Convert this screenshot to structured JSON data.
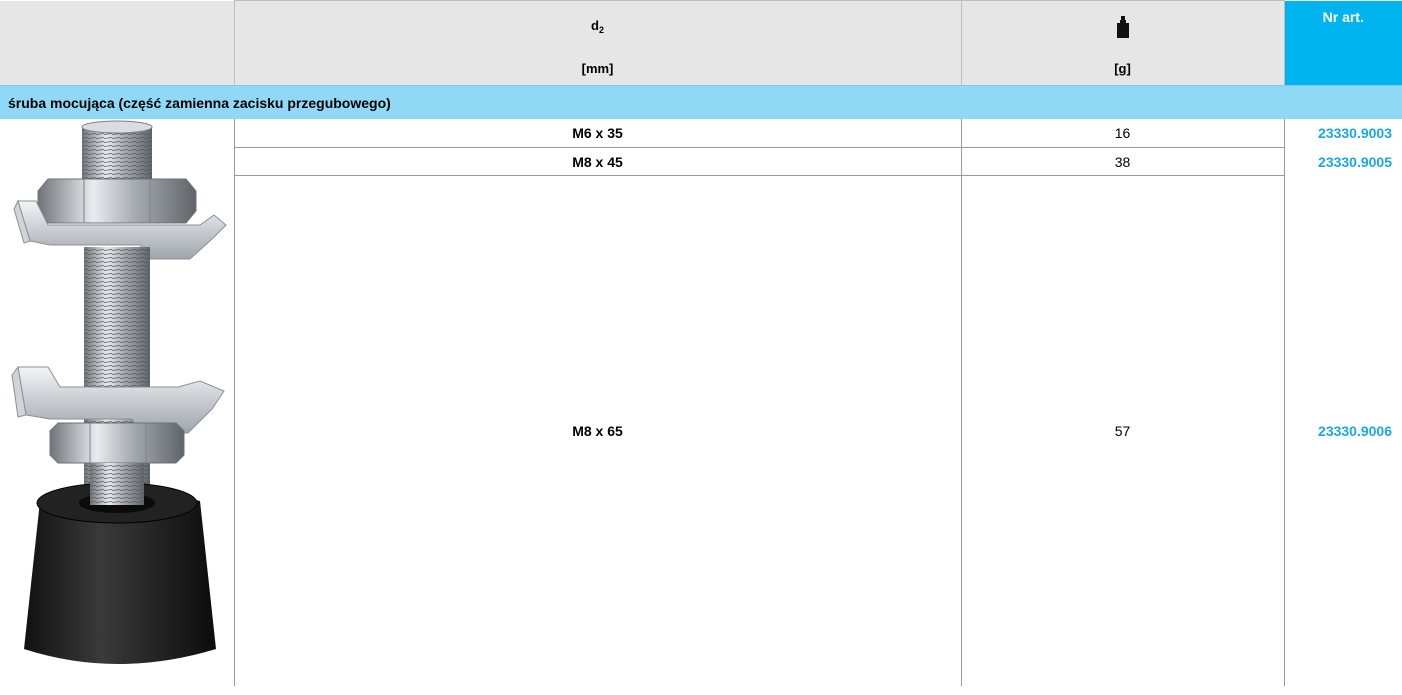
{
  "header": {
    "col1_symbol": "d",
    "col1_subscript": "2",
    "col1_unit": "[mm]",
    "col2_icon": "weight-icon",
    "col2_unit": "[g]",
    "col3_label": "Nr art."
  },
  "section": {
    "title": "śruba mocująca (część zamienna zacisku przegubowego)"
  },
  "rows": [
    {
      "size": "M6 x 35",
      "weight": "16",
      "article": "23330.9003"
    },
    {
      "size": "M8 x 45",
      "weight": "38",
      "article": "23330.9005"
    },
    {
      "size": "M8 x 65",
      "weight": "57",
      "article": "23330.9006"
    }
  ],
  "colors": {
    "header_bg": "#e6e6e6",
    "accent": "#00b5ef",
    "section_bg": "#8fd8f6",
    "article_text": "#1aa7e6"
  }
}
